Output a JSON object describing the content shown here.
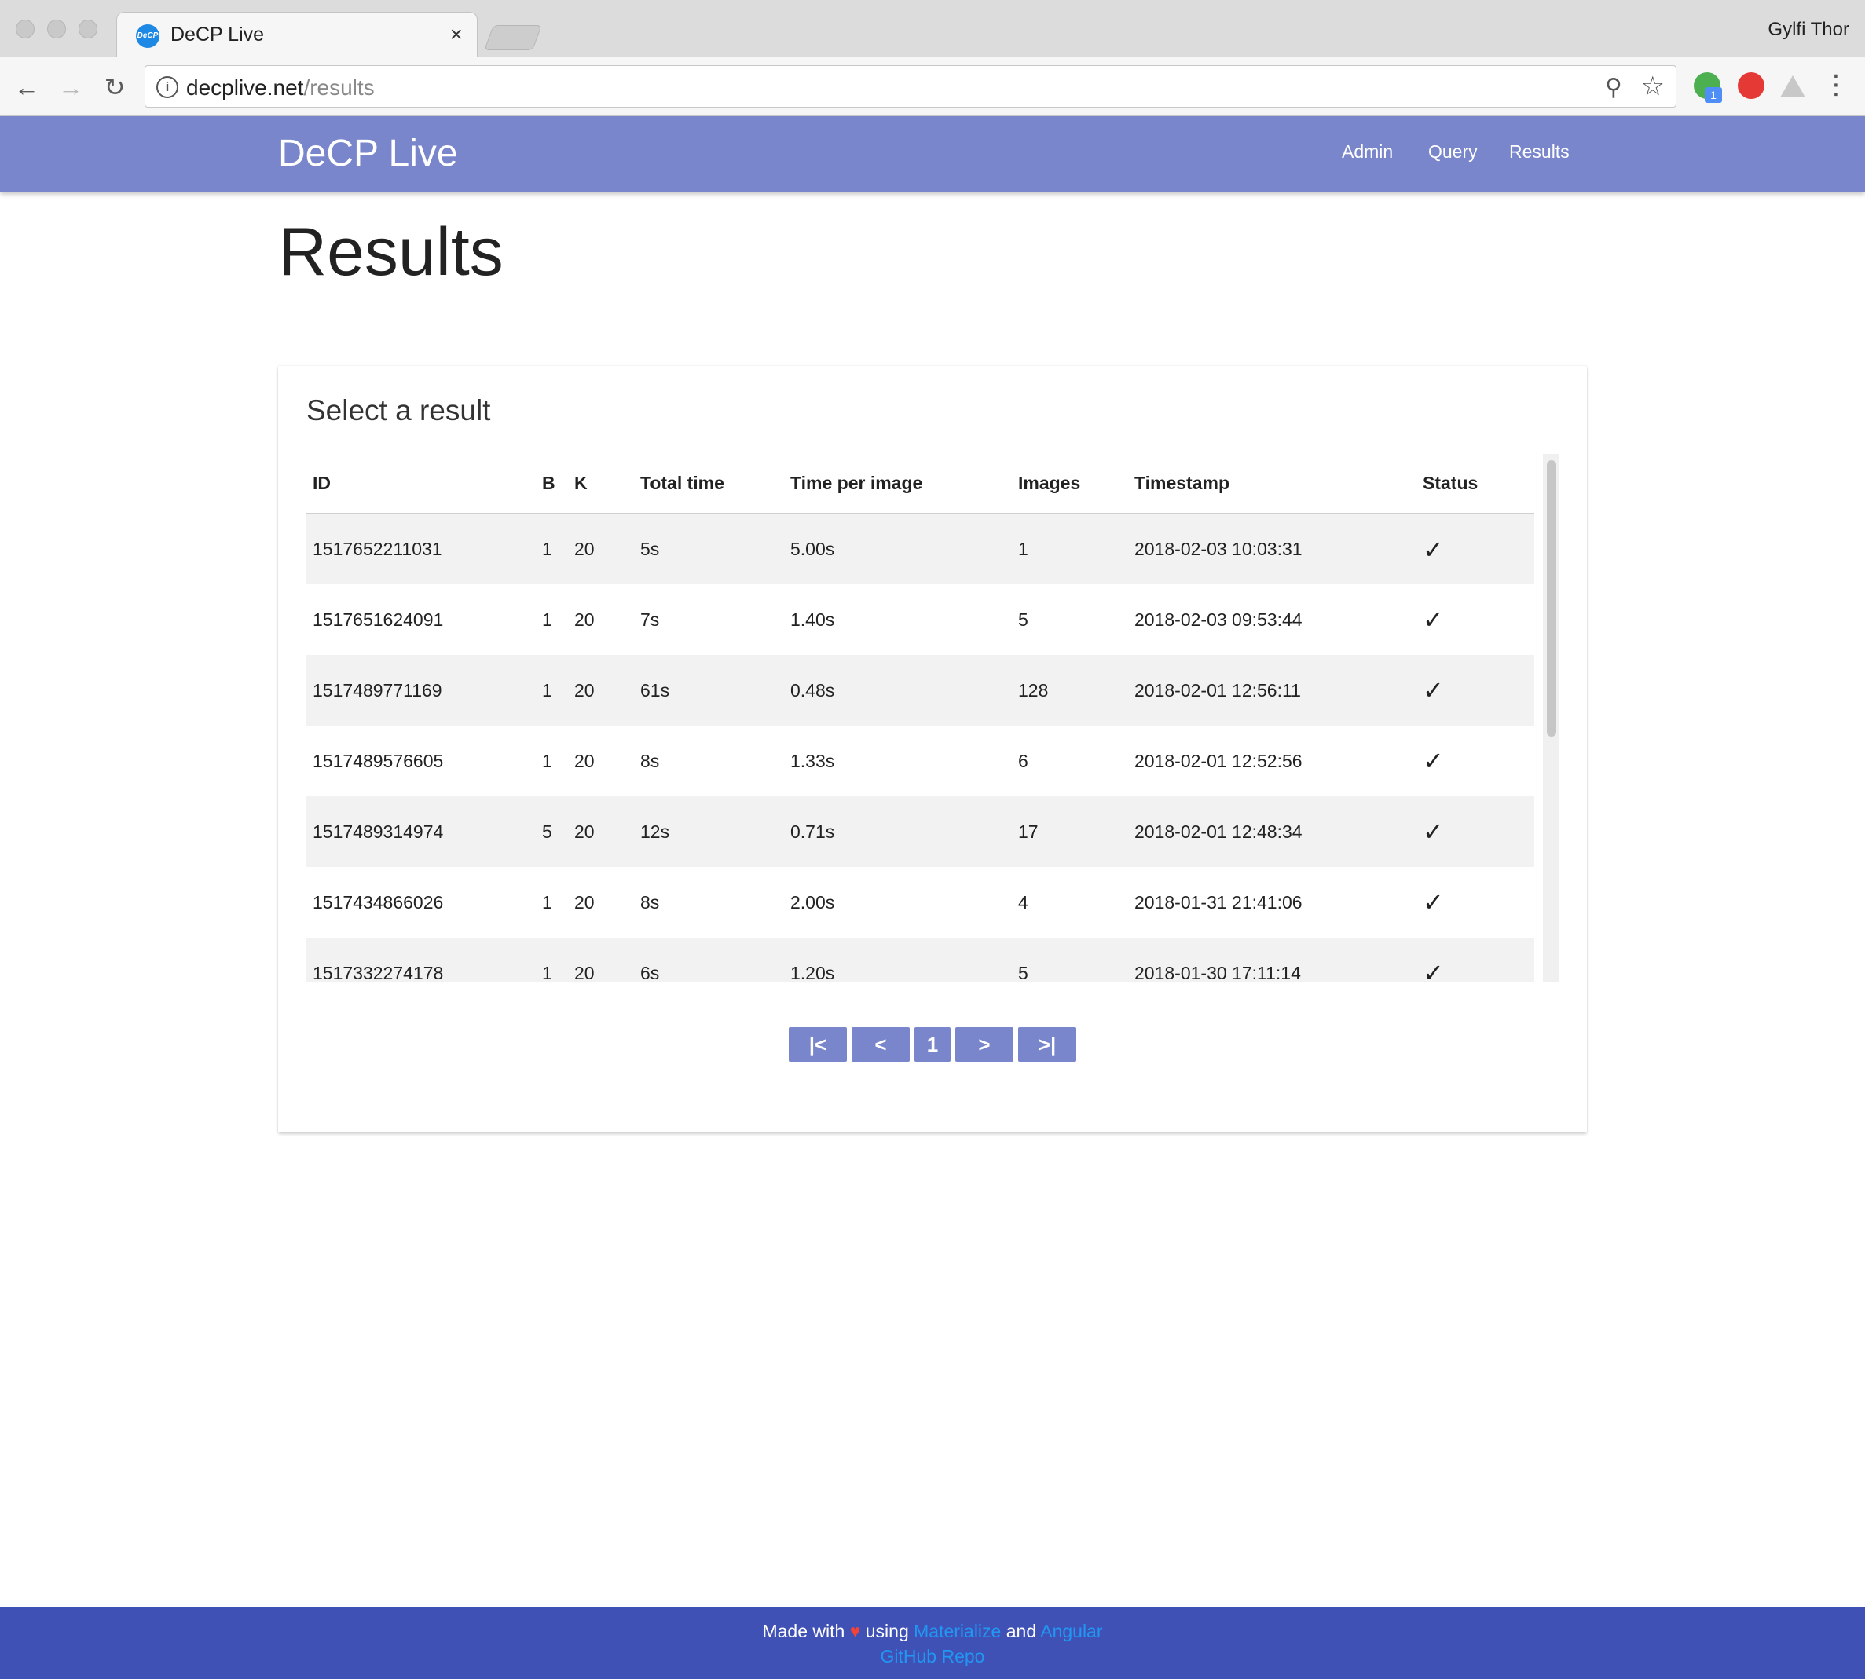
{
  "browser": {
    "tab_title": "DeCP Live",
    "favicon_text": "DeCP",
    "close_glyph": "×",
    "profile_name": "Gylfi Thor",
    "url_host": "decplive.net",
    "url_path": "/results",
    "ext_badge": "1"
  },
  "navbar": {
    "brand": "DeCP Live",
    "links": [
      "Admin",
      "Query",
      "Results"
    ]
  },
  "page": {
    "title": "Results",
    "card_title": "Select a result"
  },
  "table": {
    "columns": [
      "ID",
      "B",
      "K",
      "Total time",
      "Time per image",
      "Images",
      "Timestamp",
      "Status"
    ],
    "rows": [
      {
        "id": "1517652211031",
        "b": "1",
        "k": "20",
        "total": "5s",
        "per_image": "5.00s",
        "images": "1",
        "timestamp": "2018-02-03 10:03:31",
        "status": "✓"
      },
      {
        "id": "1517651624091",
        "b": "1",
        "k": "20",
        "total": "7s",
        "per_image": "1.40s",
        "images": "5",
        "timestamp": "2018-02-03 09:53:44",
        "status": "✓"
      },
      {
        "id": "1517489771169",
        "b": "1",
        "k": "20",
        "total": "61s",
        "per_image": "0.48s",
        "images": "128",
        "timestamp": "2018-02-01 12:56:11",
        "status": "✓"
      },
      {
        "id": "1517489576605",
        "b": "1",
        "k": "20",
        "total": "8s",
        "per_image": "1.33s",
        "images": "6",
        "timestamp": "2018-02-01 12:52:56",
        "status": "✓"
      },
      {
        "id": "1517489314974",
        "b": "5",
        "k": "20",
        "total": "12s",
        "per_image": "0.71s",
        "images": "17",
        "timestamp": "2018-02-01 12:48:34",
        "status": "✓"
      },
      {
        "id": "1517434866026",
        "b": "1",
        "k": "20",
        "total": "8s",
        "per_image": "2.00s",
        "images": "4",
        "timestamp": "2018-01-31 21:41:06",
        "status": "✓"
      },
      {
        "id": "1517332274178",
        "b": "1",
        "k": "20",
        "total": "6s",
        "per_image": "1.20s",
        "images": "5",
        "timestamp": "2018-01-30 17:11:14",
        "status": "✓"
      }
    ]
  },
  "pagination": {
    "first": "|<",
    "prev": "<",
    "page": "1",
    "next": ">",
    "last": ">|"
  },
  "footer": {
    "made_with": "Made with",
    "heart": "♥",
    "using": "using",
    "link1": "Materialize",
    "and": "and",
    "link2": "Angular",
    "repo": "GitHub Repo"
  },
  "colors": {
    "navbar": "#7986cb",
    "footer": "#3f51b5",
    "link": "#2196f3",
    "heart": "#f44336"
  }
}
